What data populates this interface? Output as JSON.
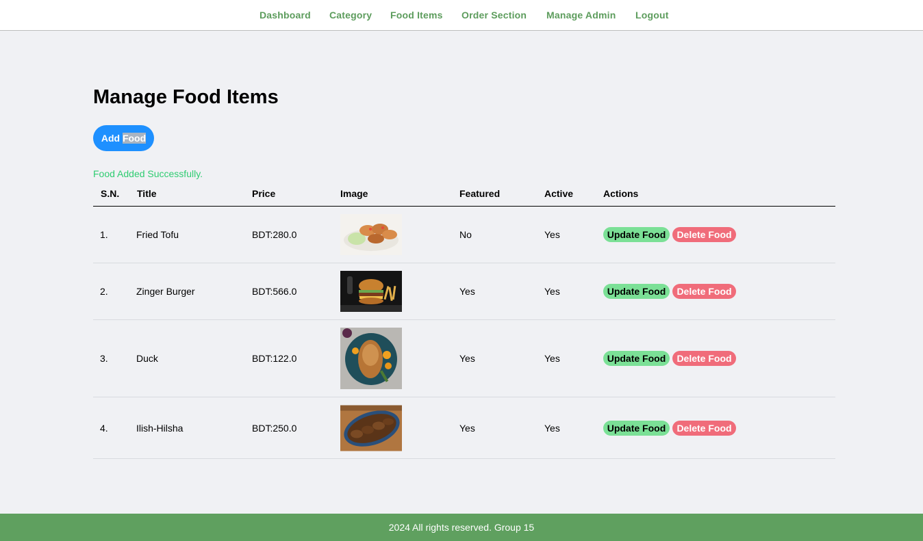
{
  "nav": {
    "items": [
      {
        "label": "Dashboard"
      },
      {
        "label": "Category"
      },
      {
        "label": "Food Items"
      },
      {
        "label": "Order Section"
      },
      {
        "label": "Manage Admin"
      },
      {
        "label": "Logout"
      }
    ]
  },
  "main": {
    "title": "Manage Food Items",
    "add_button_prefix": "Add",
    "add_button_highlight": "Food",
    "success_message": "Food Added Successfully."
  },
  "table": {
    "headers": [
      "S.N.",
      "Title",
      "Price",
      "Image",
      "Featured",
      "Active",
      "Actions"
    ],
    "update_label": "Update Food",
    "delete_label": "Delete Food",
    "rows": [
      {
        "sn": "1.",
        "title": "Fried Tofu",
        "price": "BDT:280.0",
        "image": "fried-tofu-photo",
        "featured": "No",
        "active": "Yes"
      },
      {
        "sn": "2.",
        "title": "Zinger Burger",
        "price": "BDT:566.0",
        "image": "zinger-burger-photo",
        "featured": "Yes",
        "active": "Yes"
      },
      {
        "sn": "3.",
        "title": "Duck",
        "price": "BDT:122.0",
        "image": "duck-photo",
        "featured": "Yes",
        "active": "Yes"
      },
      {
        "sn": "4.",
        "title": "Ilish-Hilsha",
        "price": "BDT:250.0",
        "image": "ilish-hilsha-photo",
        "featured": "Yes",
        "active": "Yes"
      }
    ]
  },
  "footer": {
    "text": "2024 All rights reserved. Group 15"
  },
  "colors": {
    "nav_link": "#5c9c5c",
    "add_button": "#1e90ff",
    "success": "#2ecc71",
    "update_button": "#7be096",
    "delete_button": "#f06c7a",
    "footer": "#5fa05f"
  }
}
